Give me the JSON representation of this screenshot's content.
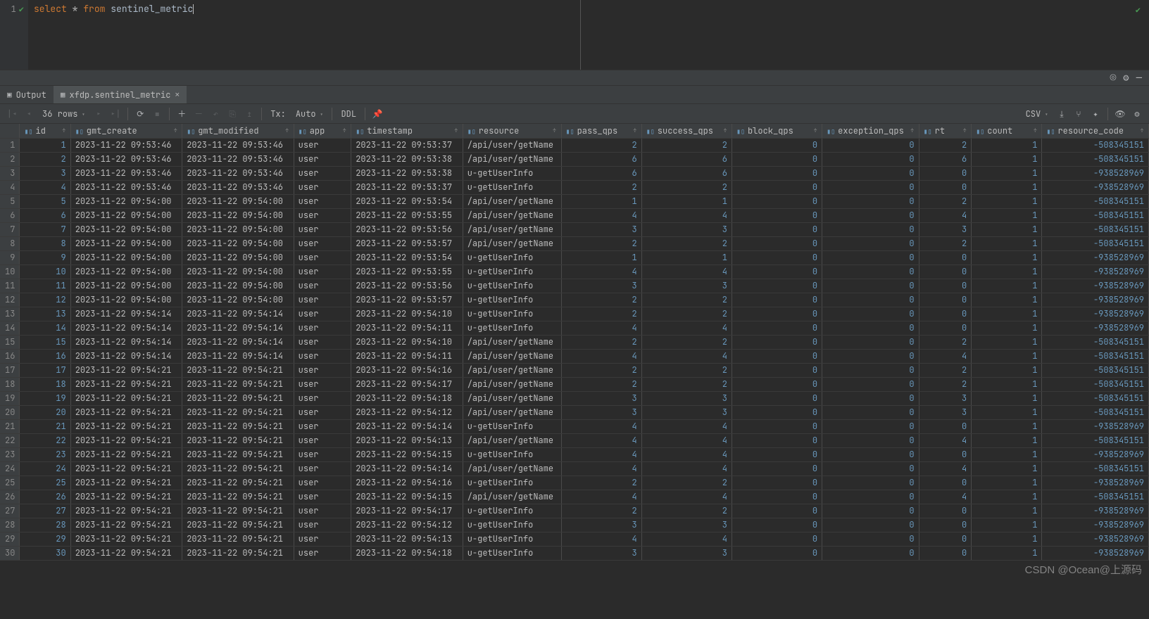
{
  "editor": {
    "line_no": "1",
    "sql_kw1": "select",
    "sql_star": "*",
    "sql_kw2": "from",
    "sql_ident": "sentinel_metric"
  },
  "tabs": {
    "output": "Output",
    "table_tab": "xfdp.sentinel_metric"
  },
  "toolbar": {
    "rows_info": "36 rows",
    "tx_label": "Tx:",
    "tx_value": "Auto",
    "ddl": "DDL",
    "export_fmt": "CSV"
  },
  "columns": [
    {
      "key": "id",
      "label": "id",
      "type": "num"
    },
    {
      "key": "gmt_create",
      "label": "gmt_create",
      "type": "str"
    },
    {
      "key": "gmt_modified",
      "label": "gmt_modified",
      "type": "str"
    },
    {
      "key": "app",
      "label": "app",
      "type": "str"
    },
    {
      "key": "timestamp",
      "label": "timestamp",
      "type": "str"
    },
    {
      "key": "resource",
      "label": "resource",
      "type": "str"
    },
    {
      "key": "pass_qps",
      "label": "pass_qps",
      "type": "num"
    },
    {
      "key": "success_qps",
      "label": "success_qps",
      "type": "num"
    },
    {
      "key": "block_qps",
      "label": "block_qps",
      "type": "num"
    },
    {
      "key": "exception_qps",
      "label": "exception_qps",
      "type": "num"
    },
    {
      "key": "rt",
      "label": "rt",
      "type": "num"
    },
    {
      "key": "count",
      "label": "count",
      "type": "num"
    },
    {
      "key": "resource_code",
      "label": "resource_code",
      "type": "num"
    }
  ],
  "rows": [
    {
      "id": 1,
      "gmt_create": "2023-11-22 09:53:46",
      "gmt_modified": "2023-11-22 09:53:46",
      "app": "user",
      "timestamp": "2023-11-22 09:53:37",
      "resource": "/api/user/getName",
      "pass_qps": 2,
      "success_qps": 2,
      "block_qps": 0,
      "exception_qps": 0,
      "rt": 2,
      "count": 1,
      "resource_code": -508345151
    },
    {
      "id": 2,
      "gmt_create": "2023-11-22 09:53:46",
      "gmt_modified": "2023-11-22 09:53:46",
      "app": "user",
      "timestamp": "2023-11-22 09:53:38",
      "resource": "/api/user/getName",
      "pass_qps": 6,
      "success_qps": 6,
      "block_qps": 0,
      "exception_qps": 0,
      "rt": 6,
      "count": 1,
      "resource_code": -508345151
    },
    {
      "id": 3,
      "gmt_create": "2023-11-22 09:53:46",
      "gmt_modified": "2023-11-22 09:53:46",
      "app": "user",
      "timestamp": "2023-11-22 09:53:38",
      "resource": "u-getUserInfo",
      "pass_qps": 6,
      "success_qps": 6,
      "block_qps": 0,
      "exception_qps": 0,
      "rt": 0,
      "count": 1,
      "resource_code": -938528969
    },
    {
      "id": 4,
      "gmt_create": "2023-11-22 09:53:46",
      "gmt_modified": "2023-11-22 09:53:46",
      "app": "user",
      "timestamp": "2023-11-22 09:53:37",
      "resource": "u-getUserInfo",
      "pass_qps": 2,
      "success_qps": 2,
      "block_qps": 0,
      "exception_qps": 0,
      "rt": 0,
      "count": 1,
      "resource_code": -938528969
    },
    {
      "id": 5,
      "gmt_create": "2023-11-22 09:54:00",
      "gmt_modified": "2023-11-22 09:54:00",
      "app": "user",
      "timestamp": "2023-11-22 09:53:54",
      "resource": "/api/user/getName",
      "pass_qps": 1,
      "success_qps": 1,
      "block_qps": 0,
      "exception_qps": 0,
      "rt": 2,
      "count": 1,
      "resource_code": -508345151
    },
    {
      "id": 6,
      "gmt_create": "2023-11-22 09:54:00",
      "gmt_modified": "2023-11-22 09:54:00",
      "app": "user",
      "timestamp": "2023-11-22 09:53:55",
      "resource": "/api/user/getName",
      "pass_qps": 4,
      "success_qps": 4,
      "block_qps": 0,
      "exception_qps": 0,
      "rt": 4,
      "count": 1,
      "resource_code": -508345151
    },
    {
      "id": 7,
      "gmt_create": "2023-11-22 09:54:00",
      "gmt_modified": "2023-11-22 09:54:00",
      "app": "user",
      "timestamp": "2023-11-22 09:53:56",
      "resource": "/api/user/getName",
      "pass_qps": 3,
      "success_qps": 3,
      "block_qps": 0,
      "exception_qps": 0,
      "rt": 3,
      "count": 1,
      "resource_code": -508345151
    },
    {
      "id": 8,
      "gmt_create": "2023-11-22 09:54:00",
      "gmt_modified": "2023-11-22 09:54:00",
      "app": "user",
      "timestamp": "2023-11-22 09:53:57",
      "resource": "/api/user/getName",
      "pass_qps": 2,
      "success_qps": 2,
      "block_qps": 0,
      "exception_qps": 0,
      "rt": 2,
      "count": 1,
      "resource_code": -508345151
    },
    {
      "id": 9,
      "gmt_create": "2023-11-22 09:54:00",
      "gmt_modified": "2023-11-22 09:54:00",
      "app": "user",
      "timestamp": "2023-11-22 09:53:54",
      "resource": "u-getUserInfo",
      "pass_qps": 1,
      "success_qps": 1,
      "block_qps": 0,
      "exception_qps": 0,
      "rt": 0,
      "count": 1,
      "resource_code": -938528969
    },
    {
      "id": 10,
      "gmt_create": "2023-11-22 09:54:00",
      "gmt_modified": "2023-11-22 09:54:00",
      "app": "user",
      "timestamp": "2023-11-22 09:53:55",
      "resource": "u-getUserInfo",
      "pass_qps": 4,
      "success_qps": 4,
      "block_qps": 0,
      "exception_qps": 0,
      "rt": 0,
      "count": 1,
      "resource_code": -938528969
    },
    {
      "id": 11,
      "gmt_create": "2023-11-22 09:54:00",
      "gmt_modified": "2023-11-22 09:54:00",
      "app": "user",
      "timestamp": "2023-11-22 09:53:56",
      "resource": "u-getUserInfo",
      "pass_qps": 3,
      "success_qps": 3,
      "block_qps": 0,
      "exception_qps": 0,
      "rt": 0,
      "count": 1,
      "resource_code": -938528969
    },
    {
      "id": 12,
      "gmt_create": "2023-11-22 09:54:00",
      "gmt_modified": "2023-11-22 09:54:00",
      "app": "user",
      "timestamp": "2023-11-22 09:53:57",
      "resource": "u-getUserInfo",
      "pass_qps": 2,
      "success_qps": 2,
      "block_qps": 0,
      "exception_qps": 0,
      "rt": 0,
      "count": 1,
      "resource_code": -938528969
    },
    {
      "id": 13,
      "gmt_create": "2023-11-22 09:54:14",
      "gmt_modified": "2023-11-22 09:54:14",
      "app": "user",
      "timestamp": "2023-11-22 09:54:10",
      "resource": "u-getUserInfo",
      "pass_qps": 2,
      "success_qps": 2,
      "block_qps": 0,
      "exception_qps": 0,
      "rt": 0,
      "count": 1,
      "resource_code": -938528969
    },
    {
      "id": 14,
      "gmt_create": "2023-11-22 09:54:14",
      "gmt_modified": "2023-11-22 09:54:14",
      "app": "user",
      "timestamp": "2023-11-22 09:54:11",
      "resource": "u-getUserInfo",
      "pass_qps": 4,
      "success_qps": 4,
      "block_qps": 0,
      "exception_qps": 0,
      "rt": 0,
      "count": 1,
      "resource_code": -938528969
    },
    {
      "id": 15,
      "gmt_create": "2023-11-22 09:54:14",
      "gmt_modified": "2023-11-22 09:54:14",
      "app": "user",
      "timestamp": "2023-11-22 09:54:10",
      "resource": "/api/user/getName",
      "pass_qps": 2,
      "success_qps": 2,
      "block_qps": 0,
      "exception_qps": 0,
      "rt": 2,
      "count": 1,
      "resource_code": -508345151
    },
    {
      "id": 16,
      "gmt_create": "2023-11-22 09:54:14",
      "gmt_modified": "2023-11-22 09:54:14",
      "app": "user",
      "timestamp": "2023-11-22 09:54:11",
      "resource": "/api/user/getName",
      "pass_qps": 4,
      "success_qps": 4,
      "block_qps": 0,
      "exception_qps": 0,
      "rt": 4,
      "count": 1,
      "resource_code": -508345151
    },
    {
      "id": 17,
      "gmt_create": "2023-11-22 09:54:21",
      "gmt_modified": "2023-11-22 09:54:21",
      "app": "user",
      "timestamp": "2023-11-22 09:54:16",
      "resource": "/api/user/getName",
      "pass_qps": 2,
      "success_qps": 2,
      "block_qps": 0,
      "exception_qps": 0,
      "rt": 2,
      "count": 1,
      "resource_code": -508345151
    },
    {
      "id": 18,
      "gmt_create": "2023-11-22 09:54:21",
      "gmt_modified": "2023-11-22 09:54:21",
      "app": "user",
      "timestamp": "2023-11-22 09:54:17",
      "resource": "/api/user/getName",
      "pass_qps": 2,
      "success_qps": 2,
      "block_qps": 0,
      "exception_qps": 0,
      "rt": 2,
      "count": 1,
      "resource_code": -508345151
    },
    {
      "id": 19,
      "gmt_create": "2023-11-22 09:54:21",
      "gmt_modified": "2023-11-22 09:54:21",
      "app": "user",
      "timestamp": "2023-11-22 09:54:18",
      "resource": "/api/user/getName",
      "pass_qps": 3,
      "success_qps": 3,
      "block_qps": 0,
      "exception_qps": 0,
      "rt": 3,
      "count": 1,
      "resource_code": -508345151
    },
    {
      "id": 20,
      "gmt_create": "2023-11-22 09:54:21",
      "gmt_modified": "2023-11-22 09:54:21",
      "app": "user",
      "timestamp": "2023-11-22 09:54:12",
      "resource": "/api/user/getName",
      "pass_qps": 3,
      "success_qps": 3,
      "block_qps": 0,
      "exception_qps": 0,
      "rt": 3,
      "count": 1,
      "resource_code": -508345151
    },
    {
      "id": 21,
      "gmt_create": "2023-11-22 09:54:21",
      "gmt_modified": "2023-11-22 09:54:21",
      "app": "user",
      "timestamp": "2023-11-22 09:54:14",
      "resource": "u-getUserInfo",
      "pass_qps": 4,
      "success_qps": 4,
      "block_qps": 0,
      "exception_qps": 0,
      "rt": 0,
      "count": 1,
      "resource_code": -938528969
    },
    {
      "id": 22,
      "gmt_create": "2023-11-22 09:54:21",
      "gmt_modified": "2023-11-22 09:54:21",
      "app": "user",
      "timestamp": "2023-11-22 09:54:13",
      "resource": "/api/user/getName",
      "pass_qps": 4,
      "success_qps": 4,
      "block_qps": 0,
      "exception_qps": 0,
      "rt": 4,
      "count": 1,
      "resource_code": -508345151
    },
    {
      "id": 23,
      "gmt_create": "2023-11-22 09:54:21",
      "gmt_modified": "2023-11-22 09:54:21",
      "app": "user",
      "timestamp": "2023-11-22 09:54:15",
      "resource": "u-getUserInfo",
      "pass_qps": 4,
      "success_qps": 4,
      "block_qps": 0,
      "exception_qps": 0,
      "rt": 0,
      "count": 1,
      "resource_code": -938528969
    },
    {
      "id": 24,
      "gmt_create": "2023-11-22 09:54:21",
      "gmt_modified": "2023-11-22 09:54:21",
      "app": "user",
      "timestamp": "2023-11-22 09:54:14",
      "resource": "/api/user/getName",
      "pass_qps": 4,
      "success_qps": 4,
      "block_qps": 0,
      "exception_qps": 0,
      "rt": 4,
      "count": 1,
      "resource_code": -508345151
    },
    {
      "id": 25,
      "gmt_create": "2023-11-22 09:54:21",
      "gmt_modified": "2023-11-22 09:54:21",
      "app": "user",
      "timestamp": "2023-11-22 09:54:16",
      "resource": "u-getUserInfo",
      "pass_qps": 2,
      "success_qps": 2,
      "block_qps": 0,
      "exception_qps": 0,
      "rt": 0,
      "count": 1,
      "resource_code": -938528969
    },
    {
      "id": 26,
      "gmt_create": "2023-11-22 09:54:21",
      "gmt_modified": "2023-11-22 09:54:21",
      "app": "user",
      "timestamp": "2023-11-22 09:54:15",
      "resource": "/api/user/getName",
      "pass_qps": 4,
      "success_qps": 4,
      "block_qps": 0,
      "exception_qps": 0,
      "rt": 4,
      "count": 1,
      "resource_code": -508345151
    },
    {
      "id": 27,
      "gmt_create": "2023-11-22 09:54:21",
      "gmt_modified": "2023-11-22 09:54:21",
      "app": "user",
      "timestamp": "2023-11-22 09:54:17",
      "resource": "u-getUserInfo",
      "pass_qps": 2,
      "success_qps": 2,
      "block_qps": 0,
      "exception_qps": 0,
      "rt": 0,
      "count": 1,
      "resource_code": -938528969
    },
    {
      "id": 28,
      "gmt_create": "2023-11-22 09:54:21",
      "gmt_modified": "2023-11-22 09:54:21",
      "app": "user",
      "timestamp": "2023-11-22 09:54:12",
      "resource": "u-getUserInfo",
      "pass_qps": 3,
      "success_qps": 3,
      "block_qps": 0,
      "exception_qps": 0,
      "rt": 0,
      "count": 1,
      "resource_code": -938528969
    },
    {
      "id": 29,
      "gmt_create": "2023-11-22 09:54:21",
      "gmt_modified": "2023-11-22 09:54:21",
      "app": "user",
      "timestamp": "2023-11-22 09:54:13",
      "resource": "u-getUserInfo",
      "pass_qps": 4,
      "success_qps": 4,
      "block_qps": 0,
      "exception_qps": 0,
      "rt": 0,
      "count": 1,
      "resource_code": -938528969
    },
    {
      "id": 30,
      "gmt_create": "2023-11-22 09:54:21",
      "gmt_modified": "2023-11-22 09:54:21",
      "app": "user",
      "timestamp": "2023-11-22 09:54:18",
      "resource": "u-getUserInfo",
      "pass_qps": 3,
      "success_qps": 3,
      "block_qps": 0,
      "exception_qps": 0,
      "rt": 0,
      "count": 1,
      "resource_code": -938528969
    }
  ],
  "watermark": "CSDN @Ocean@上源码"
}
